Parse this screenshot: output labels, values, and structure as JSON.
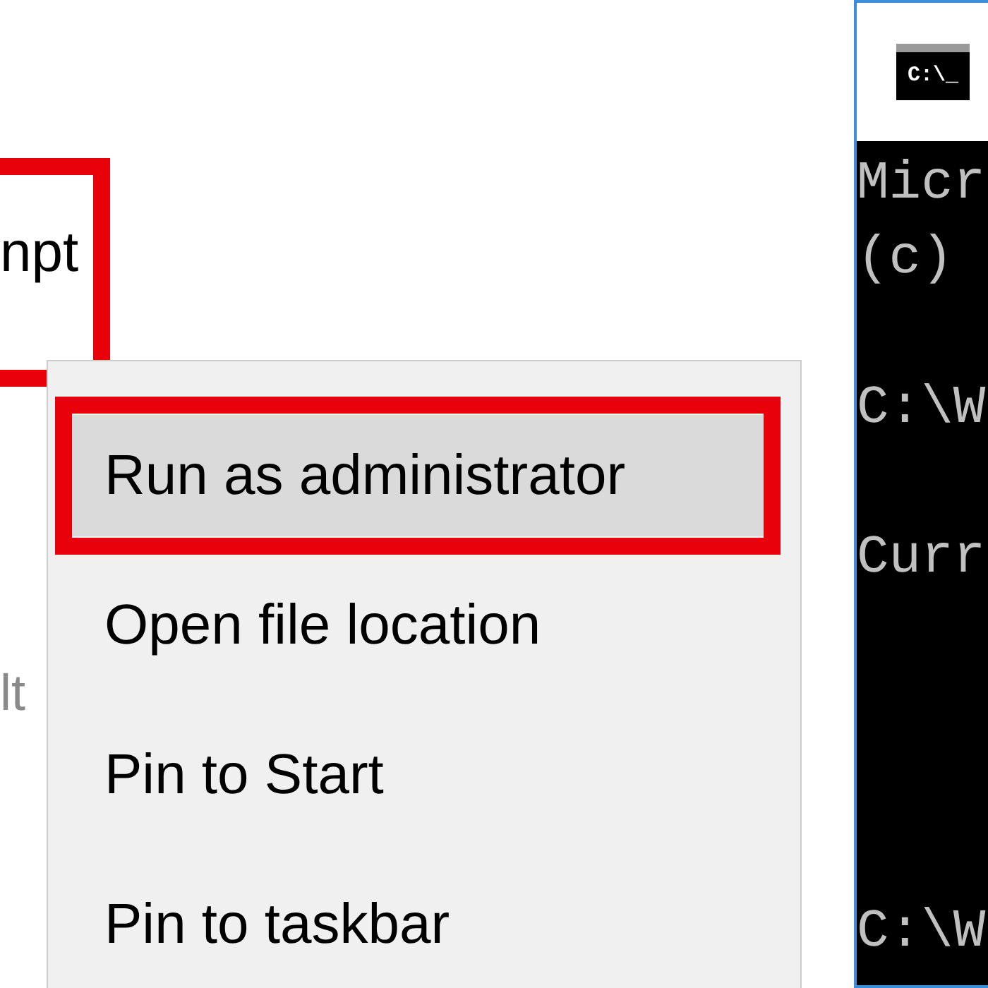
{
  "search_results": {
    "title": "npt",
    "highlighted": true,
    "subtitle": "lt"
  },
  "context_menu": {
    "items": [
      {
        "label": "Run as administrator",
        "selected": true,
        "highlighted": true
      },
      {
        "label": "Open file location",
        "selected": false,
        "highlighted": false
      },
      {
        "label": "Pin to Start",
        "selected": false,
        "highlighted": false
      },
      {
        "label": "Pin to taskbar",
        "selected": false,
        "highlighted": false
      }
    ]
  },
  "console_window": {
    "icon_text": "C:\\_",
    "lines": [
      {
        "kind": "text",
        "text": "Micr"
      },
      {
        "kind": "text",
        "text": "(c)"
      },
      {
        "kind": "blank"
      },
      {
        "kind": "text",
        "text": "C:\\W"
      },
      {
        "kind": "blank"
      },
      {
        "kind": "text",
        "text": "Curr"
      },
      {
        "kind": "blank"
      },
      {
        "kind": "blank"
      },
      {
        "kind": "blank"
      },
      {
        "kind": "blank"
      },
      {
        "kind": "text",
        "text": "C:\\W"
      }
    ]
  }
}
